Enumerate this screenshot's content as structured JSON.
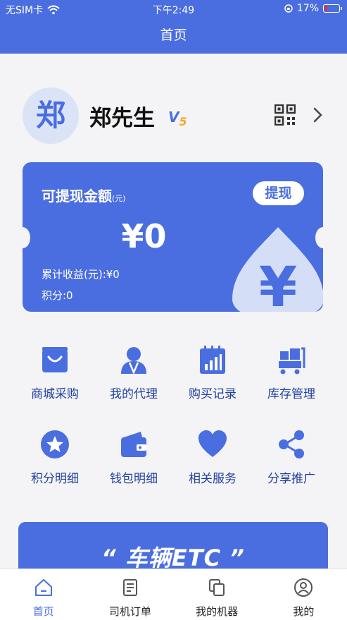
{
  "status_bar": {
    "carrier": "无SIM卡",
    "time": "下午2:49",
    "battery": "17%"
  },
  "nav": {
    "title": "首页"
  },
  "profile": {
    "avatar_text": "郑",
    "name": "郑先生",
    "level_prefix": "V",
    "level_num": "5"
  },
  "balance_card": {
    "title": "可提现金额",
    "title_unit": "(元)",
    "withdraw_label": "提现",
    "amount": "¥0",
    "total_income": "累计收益(元):¥0",
    "points": "积分:0",
    "coin_symbol": "¥"
  },
  "menu_row1": [
    {
      "label": "商城采购",
      "icon": "shopping-bag-icon"
    },
    {
      "label": "我的代理",
      "icon": "agent-icon"
    },
    {
      "label": "购买记录",
      "icon": "purchase-record-icon"
    },
    {
      "label": "库存管理",
      "icon": "inventory-icon"
    }
  ],
  "menu_row2": [
    {
      "label": "积分明细",
      "icon": "star-icon"
    },
    {
      "label": "钱包明细",
      "icon": "wallet-icon"
    },
    {
      "label": "相关服务",
      "icon": "heart-icon"
    },
    {
      "label": "分享推广",
      "icon": "share-icon"
    }
  ],
  "banner": {
    "text": "“ 车辆ETC ”"
  },
  "tabbar": [
    {
      "label": "首页",
      "icon": "home-icon",
      "active": true
    },
    {
      "label": "司机订单",
      "icon": "orders-icon",
      "active": false
    },
    {
      "label": "我的机器",
      "icon": "machine-icon",
      "active": false
    },
    {
      "label": "我的",
      "icon": "user-icon",
      "active": false
    }
  ],
  "colors": {
    "primary": "#4a6ee0",
    "accent": "#f5a623",
    "menu_text": "#1f3f9e"
  }
}
